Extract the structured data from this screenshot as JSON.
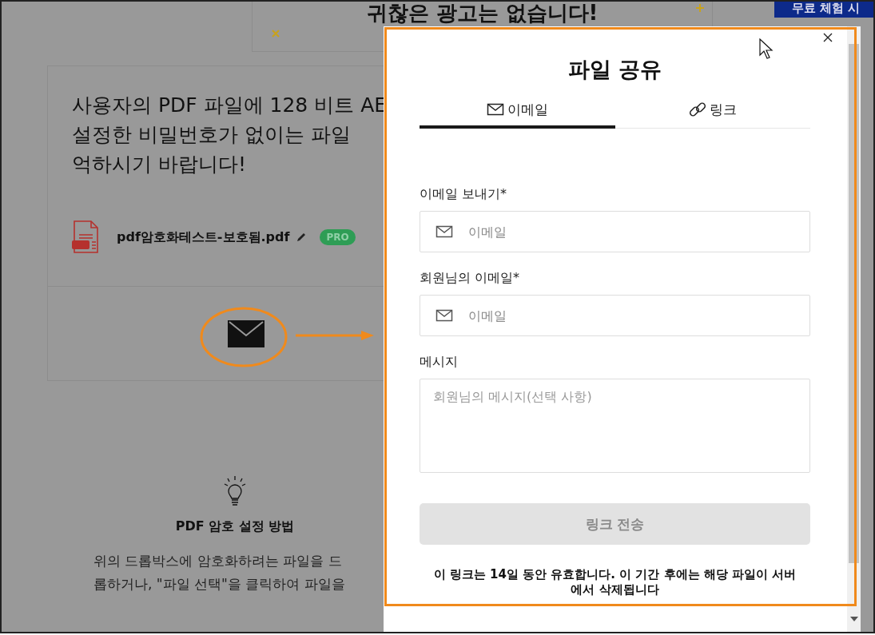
{
  "background_page": {
    "headline": "귀찮은 광고는 없습니다!",
    "trial_button": "무료 체험 시",
    "description_lines": [
      "사용자의 PDF 파일에 128 비트 AE",
      "설정한 비밀번호가 없이는 파일",
      "억하시기 바랍니다!"
    ],
    "file": {
      "name": "pdf암호화테스트-보호됨.pdf",
      "badge": "PRO"
    },
    "tip_title": "PDF 암호 설정 방법",
    "tip_lines": [
      "위의 드롭박스에 암호화하려는 파일을 드",
      "롭하거나, \"파일 선택\"을 클릭하여 파일을"
    ]
  },
  "dialog": {
    "title": "파일 공유",
    "tabs": [
      {
        "label": "이메일",
        "kind": "email",
        "selected": true
      },
      {
        "label": "링크",
        "kind": "link",
        "selected": false
      }
    ],
    "fields": [
      {
        "label": "이메일 보내기*",
        "placeholder": "이메일",
        "kind": "input"
      },
      {
        "label": "회원님의 이메일*",
        "placeholder": "이메일",
        "kind": "input"
      },
      {
        "label": "메시지",
        "placeholder": "회원님의 메시지(선택 사항)",
        "kind": "textarea"
      }
    ],
    "submit": {
      "label": "링크 전송",
      "disabled": true
    },
    "note": "이 링크는 14일 동안 유효합니다. 이 기간 후에는 해당 파일이 서버에서 삭제됩니다"
  }
}
